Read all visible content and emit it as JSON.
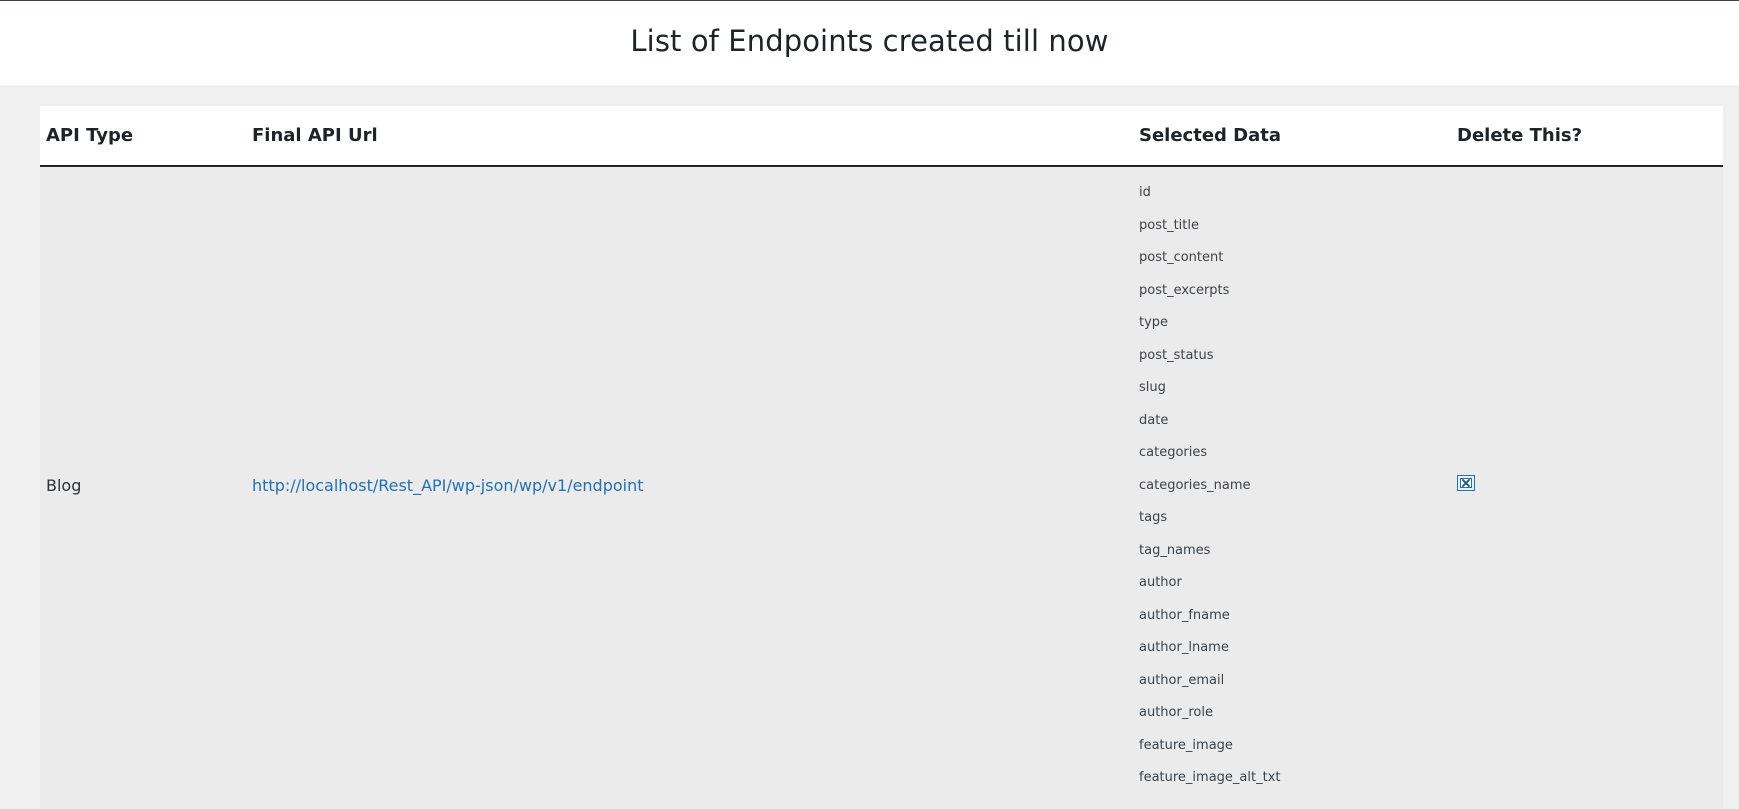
{
  "page": {
    "title": "List of Endpoints created till now"
  },
  "table": {
    "headers": {
      "api_type": "API Type",
      "final_url": "Final API Url",
      "selected_data": "Selected Data",
      "delete": "Delete This?"
    },
    "rows": [
      {
        "api_type": "Blog",
        "url": "http://localhost/Rest_API/wp-json/wp/v1/endpoint",
        "selected_data": [
          "id",
          "post_title",
          "post_content",
          "post_excerpts",
          "type",
          "post_status",
          "slug",
          "date",
          "categories",
          "categories_name",
          "tags",
          "tag_names",
          "author",
          "author_fname",
          "author_lname",
          "author_email",
          "author_role",
          "feature_image",
          "feature_image_alt_txt"
        ],
        "delete_icon": "delete-x-icon"
      }
    ]
  },
  "colors": {
    "link": "#2271b1",
    "background": "#f0f0f1",
    "row_background": "#ebebeb"
  }
}
